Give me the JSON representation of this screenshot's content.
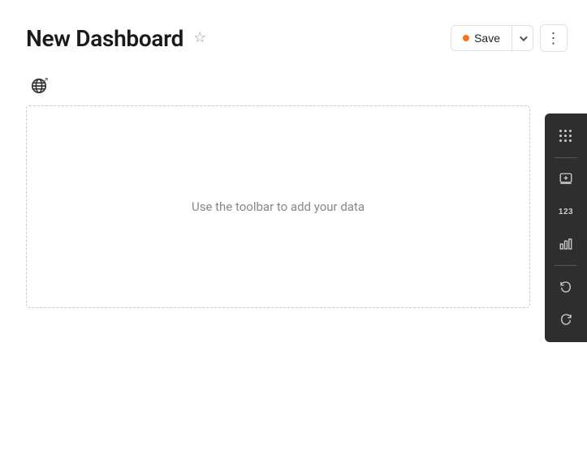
{
  "header": {
    "title": "New Dashboard",
    "star_label": "☆",
    "save_label": "Save",
    "more_label": "⋮"
  },
  "toolbar": {
    "globe_label": "Globe/Data Source"
  },
  "canvas": {
    "empty_message": "Use the toolbar to add your data"
  },
  "sidebar": {
    "items": [
      {
        "id": "grid",
        "label": "grid-icon"
      },
      {
        "id": "divider1",
        "type": "divider"
      },
      {
        "id": "add-panel",
        "label": "add-panel-icon"
      },
      {
        "id": "number",
        "label": "123"
      },
      {
        "id": "chart",
        "label": "chart-icon"
      },
      {
        "id": "divider2",
        "type": "divider"
      },
      {
        "id": "undo",
        "label": "undo-icon"
      },
      {
        "id": "redo",
        "label": "redo-icon"
      }
    ]
  }
}
